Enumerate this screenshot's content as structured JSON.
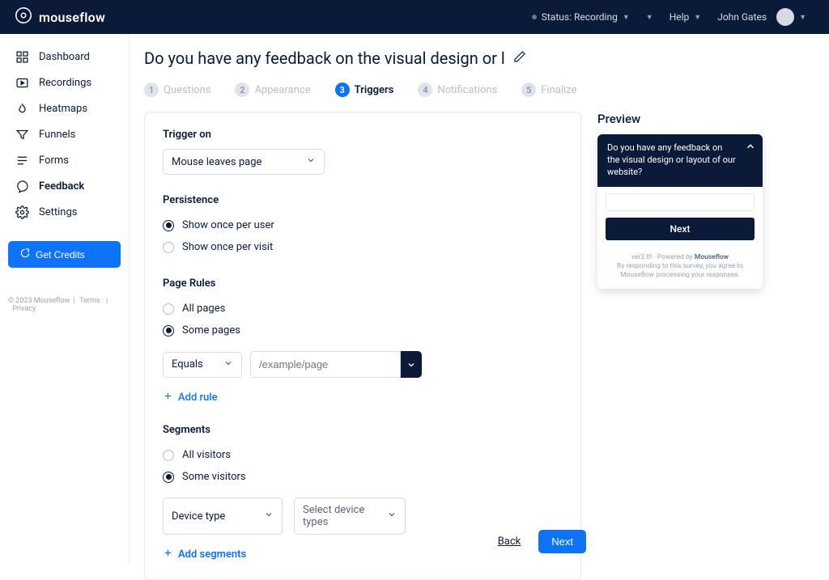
{
  "brand": "mouseflow",
  "topbar": {
    "status_label": "Status: Recording",
    "help_label": "Help",
    "user_name": "John Gates"
  },
  "sidebar": {
    "items": [
      {
        "label": "Dashboard",
        "icon": "dashboard-icon"
      },
      {
        "label": "Recordings",
        "icon": "recordings-icon"
      },
      {
        "label": "Heatmaps",
        "icon": "heatmaps-icon"
      },
      {
        "label": "Funnels",
        "icon": "funnels-icon"
      },
      {
        "label": "Forms",
        "icon": "forms-icon"
      },
      {
        "label": "Feedback",
        "icon": "feedback-icon"
      },
      {
        "label": "Settings",
        "icon": "settings-icon"
      }
    ],
    "credits_label": "Get Credits",
    "footer_copyright": "© 2023 Mouseflow",
    "footer_terms": "Terms",
    "footer_privacy": "Privacy"
  },
  "page": {
    "title": "Do you have any feedback on the visual design or l",
    "steps": [
      {
        "num": "1",
        "label": "Questions"
      },
      {
        "num": "2",
        "label": "Appearance"
      },
      {
        "num": "3",
        "label": "Triggers"
      },
      {
        "num": "4",
        "label": "Notifications"
      },
      {
        "num": "5",
        "label": "Finalize"
      }
    ],
    "active_step": 2
  },
  "trigger": {
    "section_label": "Trigger on",
    "selected": "Mouse leaves page"
  },
  "persistence": {
    "section_label": "Persistence",
    "opt_once_user": "Show once per user",
    "opt_once_visit": "Show once per visit",
    "selected": "user"
  },
  "page_rules": {
    "section_label": "Page Rules",
    "opt_all": "All pages",
    "opt_some": "Some pages",
    "selected": "some",
    "rule_op": "Equals",
    "rule_value_placeholder": "/example/page",
    "add_rule_label": "Add rule"
  },
  "segments": {
    "section_label": "Segments",
    "opt_all": "All visitors",
    "opt_some": "Some visitors",
    "selected": "some",
    "seg_type": "Device type",
    "seg_value": "Select device types",
    "add_segment_label": "Add segments"
  },
  "preview": {
    "title": "Preview",
    "question": "Do you have any feedback on the visual design or layout of our website?",
    "next_label": "Next",
    "footer_version": "ver2.0! · Powered by ",
    "footer_brand": "Mouseflow",
    "footer_disclaimer": "By responding to this survey, you agree to Mouseflow processing your responses."
  },
  "footer": {
    "back": "Back",
    "next": "Next"
  }
}
